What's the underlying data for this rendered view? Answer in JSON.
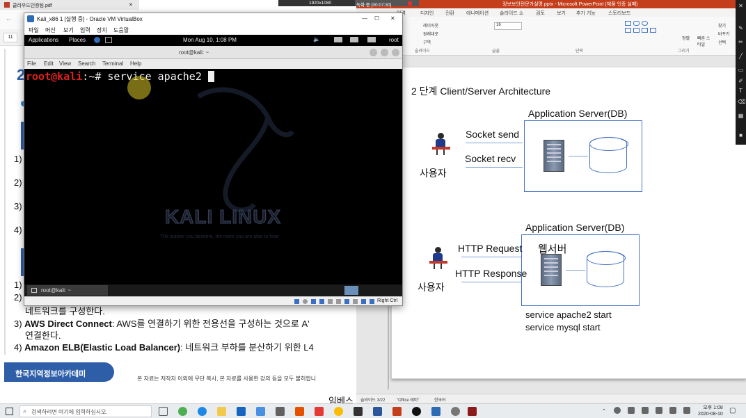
{
  "top_overlay": {
    "resolution": "1920x1080",
    "recording": "녹화 중 [00:07:30]"
  },
  "pdf": {
    "tab_title": "클라우드인증팀.pdf",
    "zoom": "11",
    "heading_num": "2",
    "list_items": [
      "1)",
      "2)",
      "3)",
      "4)"
    ],
    "list_items_2": [
      "1)",
      "2)"
    ],
    "line_network": "네트워크를 구성한다.",
    "line3_prefix": "3) ",
    "line3_bold": "AWS Direct Connect",
    "line3_rest": ": AWS를 연결하기 위한 전용선을 구성하는 것으로 A'",
    "line3_cont": "연결한다.",
    "line4_prefix": "4) ",
    "line4_bold": "Amazon ELB(Elastic Load Balancer)",
    "line4_rest": ": 네트워크 부하를 분산하기 위한 L4 ",
    "academy": "한국지역정보아카데미",
    "copyright": "본 자료는 저작자 이외에 무단 복사, 본 자료를 사용한 강의 등을 모두 불허합니",
    "bottom_word": "임베스"
  },
  "ppt": {
    "title": "정보보안전문가실명.pptx - Microsoft PowerPoint (제품 인증 실패)",
    "tabs": [
      "입력",
      "디자인",
      "전환",
      "애니메이션",
      "슬라이드 쇼",
      "검토",
      "보기",
      "추가 기능",
      "스토리보드"
    ],
    "ribbon": {
      "layout": "레이아웃",
      "reset": "원래대로",
      "section": "구역",
      "font_size": "16",
      "group_slide": "슬라이드",
      "group_font": "글꼴",
      "group_paragraph": "단락",
      "group_drawing": "그리기",
      "arrange": "정렬",
      "quick_styles": "빠른 스타일",
      "find": "찾기",
      "replace": "바꾸기",
      "select": "선택"
    },
    "status": {
      "slide": "슬라이드 3/22",
      "theme": "\"Office 테마\"",
      "lang": "한국어"
    },
    "slide": {
      "heading": "2 단계 Client/Server Architecture",
      "server1_title": "Application Server(DB)",
      "socket_send": "Socket send",
      "socket_recv": "Socket recv",
      "user1": "사용자",
      "server2_title": "Application Server(DB)",
      "http_request": "HTTP Request",
      "http_response": "HTTP Response",
      "webserver": "웹서버",
      "user2": "사용자",
      "cmd1": "service apache2 start",
      "cmd2": "service mysql start"
    }
  },
  "vbox": {
    "title": "Kali_x86 1 [실행 중] - Oracle VM VirtualBox",
    "menu": [
      "파일",
      "머신",
      "보기",
      "입력",
      "장치",
      "도움말"
    ],
    "gnome": {
      "applications": "Applications",
      "places": "Places",
      "clock": "Mon Aug 10,  1:08 PM",
      "user": "root"
    },
    "terminal": {
      "title": "root@kali: ~",
      "menu": [
        "File",
        "Edit",
        "View",
        "Search",
        "Terminal",
        "Help"
      ],
      "prompt_user": "root@kali",
      "prompt_path": ":~",
      "prompt_symbol": "# ",
      "command": "service apache2 "
    },
    "kali_logo": "KALI LINUX",
    "kali_tagline": "The quieter you become, the more you are able to hear",
    "vm_taskbar_item": "root@kali: ~",
    "host_key": "Right Ctrl"
  },
  "taskbar": {
    "search_placeholder": "검색하려면 여기에 입력하십시오.",
    "time": "오후 1:08",
    "date": "2020-08-10"
  }
}
